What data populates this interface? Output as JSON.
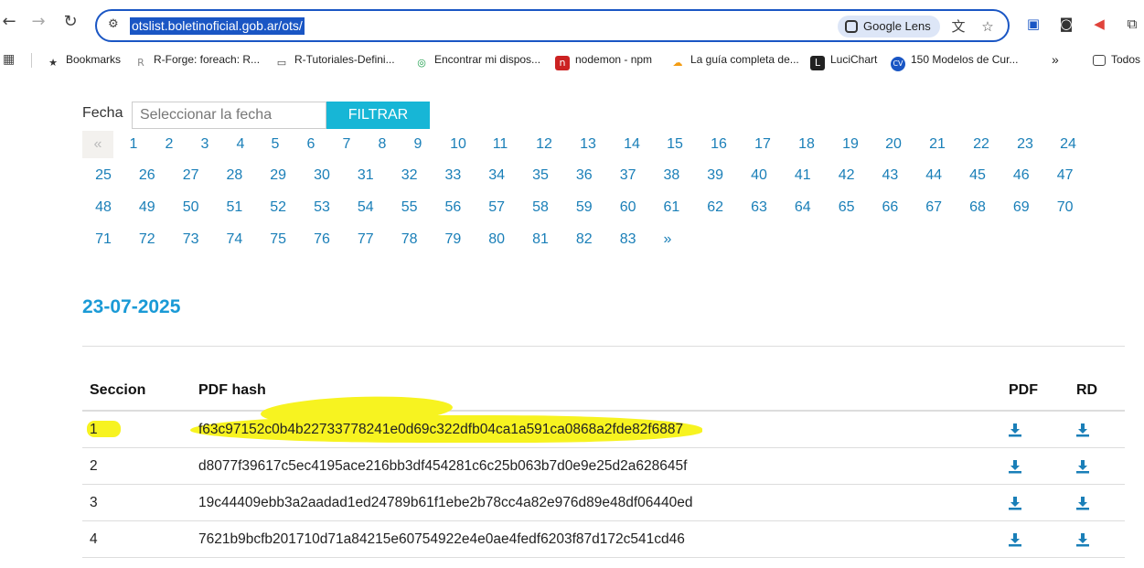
{
  "browser": {
    "url": "otslist.boletinoficial.gob.ar/ots/",
    "lens_label": "Google Lens",
    "bookmarks": [
      {
        "label": "Bookmarks",
        "icon": "star-icon",
        "color": "#333333"
      },
      {
        "label": "R-Forge: foreach: R...",
        "icon": "r-forge-icon",
        "color": "#888888"
      },
      {
        "label": "R-Tutoriales-Defini...",
        "icon": "folder-icon",
        "color": "#444444"
      },
      {
        "label": "Encontrar mi dispos...",
        "icon": "google-find-icon",
        "color": "#1a9e4a"
      },
      {
        "label": "nodemon - npm",
        "icon": "npm-icon",
        "color": "#cc2222"
      },
      {
        "label": "La guía completa de...",
        "icon": "cloud-icon",
        "color": "#f39c12"
      },
      {
        "label": "LuciChart",
        "icon": "lucidchart-icon",
        "color": "#222222"
      },
      {
        "label": "150 Modelos de Cur...",
        "icon": "cv-icon",
        "color": "#1a56c4"
      }
    ],
    "overflow_label": "»",
    "other_folder_label": "Todos"
  },
  "filter": {
    "label": "Fecha",
    "placeholder": "Seleccionar la fecha",
    "button_label": "FILTRAR"
  },
  "pagination": {
    "prev_label": "«",
    "next_label": "»",
    "pages": [
      "1",
      "2",
      "3",
      "4",
      "5",
      "6",
      "7",
      "8",
      "9",
      "10",
      "11",
      "12",
      "13",
      "14",
      "15",
      "16",
      "17",
      "18",
      "19",
      "20",
      "21",
      "22",
      "23",
      "24",
      "25",
      "26",
      "27",
      "28",
      "29",
      "30",
      "31",
      "32",
      "33",
      "34",
      "35",
      "36",
      "37",
      "38",
      "39",
      "40",
      "41",
      "42",
      "43",
      "44",
      "45",
      "46",
      "47",
      "48",
      "49",
      "50",
      "51",
      "52",
      "53",
      "54",
      "55",
      "56",
      "57",
      "58",
      "59",
      "60",
      "61",
      "62",
      "63",
      "64",
      "65",
      "66",
      "67",
      "68",
      "69",
      "70",
      "71",
      "72",
      "73",
      "74",
      "75",
      "76",
      "77",
      "78",
      "79",
      "80",
      "81",
      "82",
      "83"
    ]
  },
  "date_heading": "23-07-2025",
  "table": {
    "headers": {
      "seccion": "Seccion",
      "hash": "PDF hash",
      "pdf": "PDF",
      "rd": "RD"
    },
    "rows": [
      {
        "seccion": "1",
        "hash": "f63c97152c0b4b22733778241e0d69c322dfb04ca1a591ca0868a2fde82f6887",
        "highlighted": true
      },
      {
        "seccion": "2",
        "hash": "d8077f39617c5ec4195ace216bb3df454281c6c25b063b7d0e9e25d2a628645f",
        "highlighted": false
      },
      {
        "seccion": "3",
        "hash": "19c44409ebb3a2aadad1ed24789b61f1ebe2b78cc4a82e976d89e48df06440ed",
        "highlighted": false
      },
      {
        "seccion": "4",
        "hash": "7621b9bcfb201710d71a84215e60754922e4e0ae4fedf6203f87d172c541cd46",
        "highlighted": false
      }
    ]
  },
  "colors": {
    "accent": "#17b6d6",
    "link": "#1a7fb8",
    "heading": "#1a9ad6",
    "highlight": "#f7f320",
    "download": "#1a7fb8"
  }
}
